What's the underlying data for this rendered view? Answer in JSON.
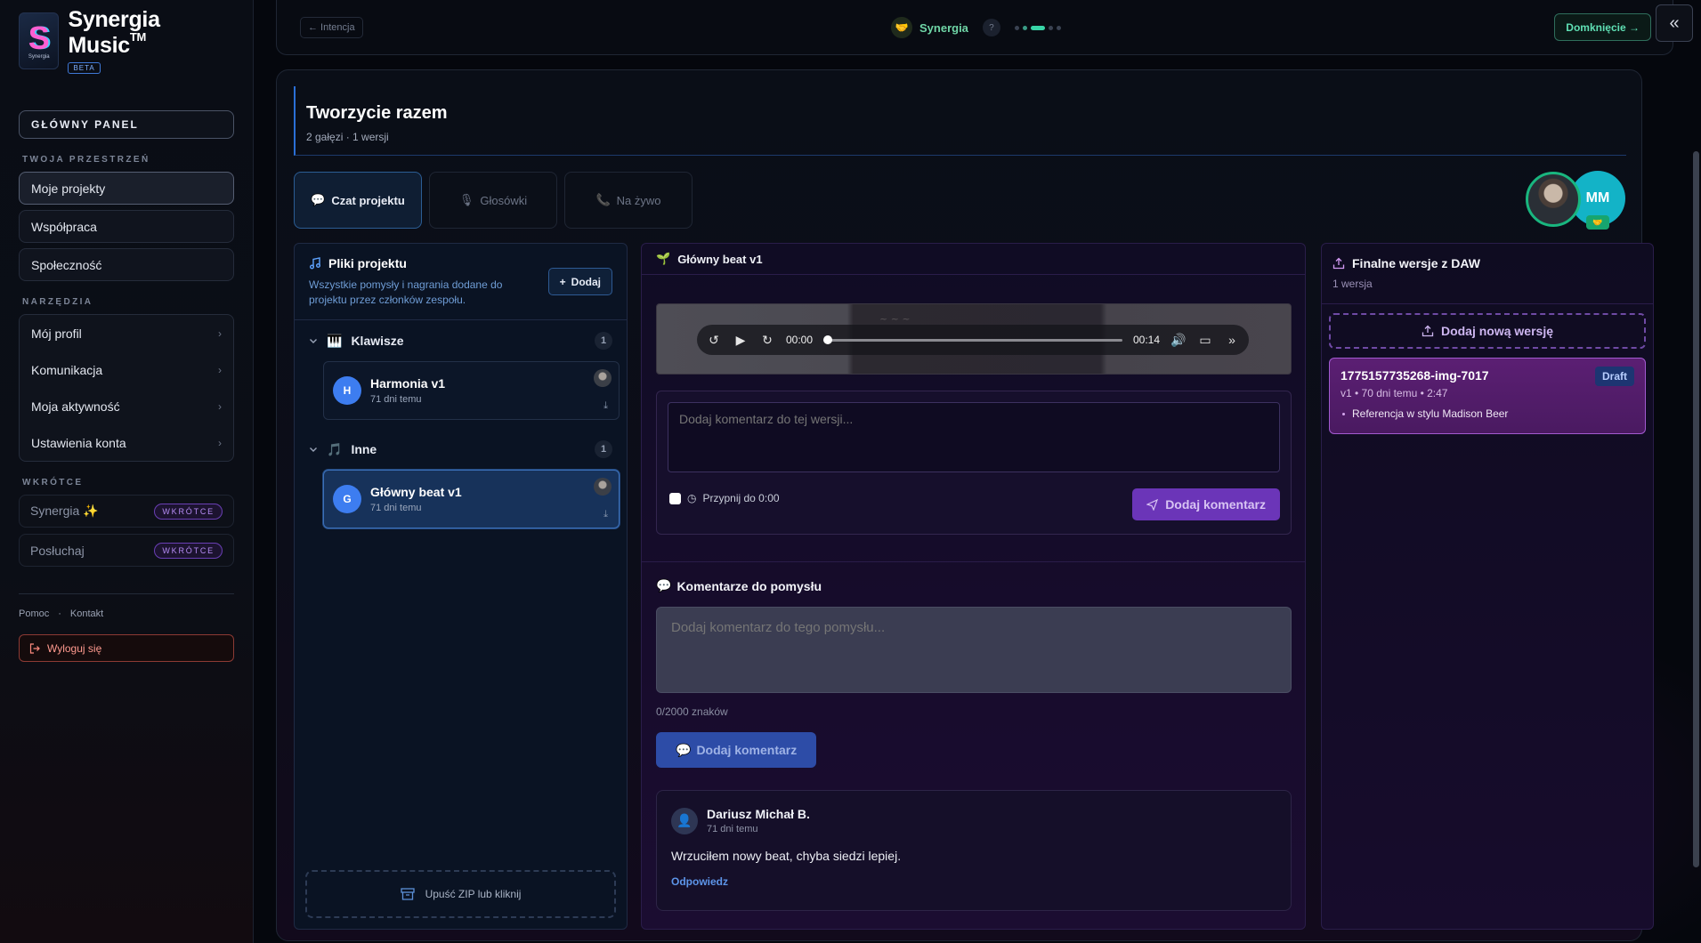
{
  "sidebar": {
    "brand_name": "Synergia Music",
    "brand_tm": "TM",
    "brand_logo_text": "Synergia",
    "beta": "BETA",
    "main_panel": "GŁÓWNY PANEL",
    "workspace_label": "TWOJA PRZESTRZEŃ",
    "workspace_items": [
      {
        "label": "Moje projekty"
      },
      {
        "label": "Współpraca"
      },
      {
        "label": "Społeczność"
      }
    ],
    "tools_label": "NARZĘDZIA",
    "tools_items": [
      {
        "label": "Mój profil"
      },
      {
        "label": "Komunikacja"
      },
      {
        "label": "Moja aktywność"
      },
      {
        "label": "Ustawienia konta"
      }
    ],
    "soon_label": "WKRÓTCE",
    "soon_items": [
      {
        "label": "Synergia ✨",
        "badge": "WKRÓTCE"
      },
      {
        "label": "Posłuchaj",
        "badge": "WKRÓTCE"
      }
    ],
    "footer_help": "Pomoc",
    "footer_sep": "·",
    "footer_contact": "Kontakt",
    "logout": "Wyloguj się"
  },
  "topbar": {
    "back": "← Intencja",
    "center_name": "Synergia",
    "help": "?",
    "finish": "Domknięcie →"
  },
  "page": {
    "title": "Tworzycie razem",
    "subtitle": "2 gałęzi · 1 wersji"
  },
  "tabs": [
    {
      "label": "Czat projektu",
      "icon": "💬"
    },
    {
      "label": "Głosówki",
      "icon": "🎙"
    },
    {
      "label": "Na żywo",
      "icon": "📞"
    }
  ],
  "avatars": {
    "initials": "MM"
  },
  "files": {
    "title": "Pliki projektu",
    "description": "Wszystkie pomysły i nagrania dodane do projektu przez członków zespołu.",
    "add": "Dodaj",
    "groups": [
      {
        "name": "Klawisze",
        "count": "1",
        "icon": "🎹",
        "items": [
          {
            "initial": "H",
            "name": "Harmonia v1",
            "time": "71 dni temu"
          }
        ]
      },
      {
        "name": "Inne",
        "count": "1",
        "icon": "🎵",
        "items": [
          {
            "initial": "G",
            "name": "Główny beat v1",
            "time": "71 dni temu"
          }
        ]
      }
    ],
    "zip": "Upuść ZIP lub kliknij"
  },
  "center": {
    "header": "Główny beat v1",
    "player": {
      "current": "00:00",
      "duration": "00:14"
    },
    "version_comment_placeholder": "Dodaj komentarz do tej wersji...",
    "pin_label": "Przypnij do 0:00",
    "send_label": "Dodaj komentarz",
    "idea_title": "Komentarze do pomysłu",
    "idea_placeholder": "Dodaj komentarz do tego pomysłu...",
    "char_count": "0/2000 znaków",
    "idea_btn": "Dodaj komentarz",
    "comment": {
      "author": "Dariusz Michał B.",
      "time": "71 dni temu",
      "text": "Wrzuciłem nowy beat, chyba siedzi lepiej.",
      "reply": "Odpowiedz"
    }
  },
  "daw": {
    "title": "Finalne wersje z DAW",
    "subtitle": "1 wersja",
    "add": "Dodaj nową wersję",
    "version": {
      "title": "1775157735268-img-7017",
      "meta": "v1 • 70 dni temu • 2:47",
      "badge": "Draft",
      "note": "Referencja w stylu Madison Beer"
    }
  }
}
